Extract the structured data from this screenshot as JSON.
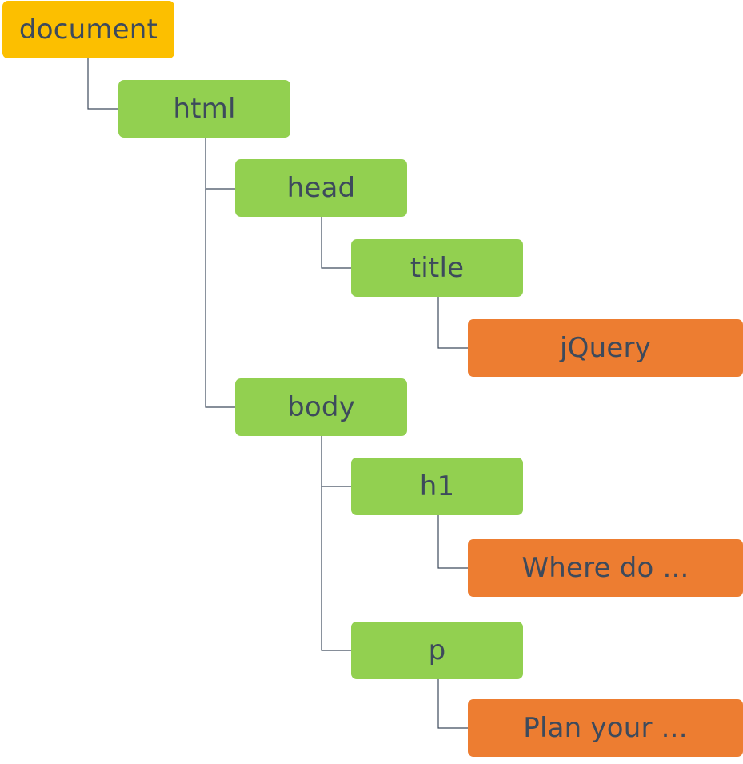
{
  "tree": {
    "document": "document",
    "html": "html",
    "head": "head",
    "title": "title",
    "title_text": "jQuery",
    "body": "body",
    "h1": "h1",
    "h1_text": "Where do ...",
    "p": "p",
    "p_text": "Plan your ..."
  },
  "colors": {
    "document_node": "#fcbf00",
    "element_node": "#92d050",
    "text_node": "#ed7d31",
    "label": "#3d4a5c",
    "connector": "#3d4a5c"
  }
}
